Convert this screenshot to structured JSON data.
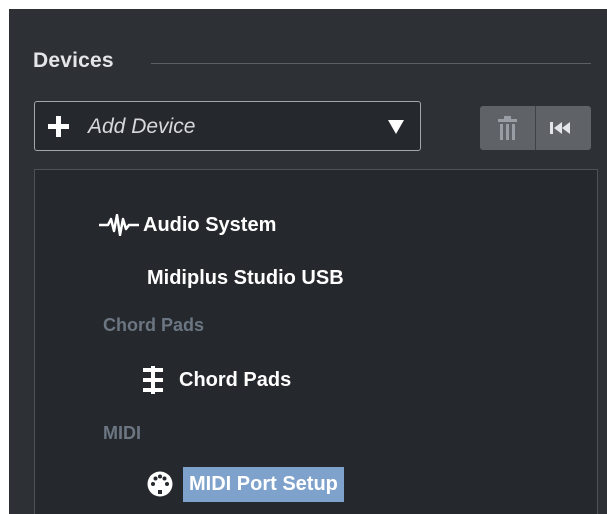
{
  "section": {
    "title": "Devices"
  },
  "add_device": {
    "plus_icon": "plus-icon",
    "label": "Add Device",
    "caret_icon": "caret-down-icon"
  },
  "toolbar": {
    "delete_icon": "trash-icon",
    "reset_icon": "rewind-to-start-icon"
  },
  "device_list": {
    "audio_system": {
      "icon": "audio-wave-icon",
      "label": "Audio System"
    },
    "midiplus": {
      "label": "Midiplus Studio USB"
    },
    "categories": {
      "chord_pads": "Chord Pads",
      "midi": "MIDI"
    },
    "chord_pads": {
      "icon": "chord-pads-icon",
      "label": "Chord Pads"
    },
    "midi_port_setup": {
      "icon": "midi-port-icon",
      "label": "MIDI Port Setup",
      "selected": true
    }
  },
  "colors": {
    "panel_background": "#2d3135",
    "list_background": "#25282c",
    "selection": "#7ea2cc",
    "category_text": "#6b7682"
  }
}
